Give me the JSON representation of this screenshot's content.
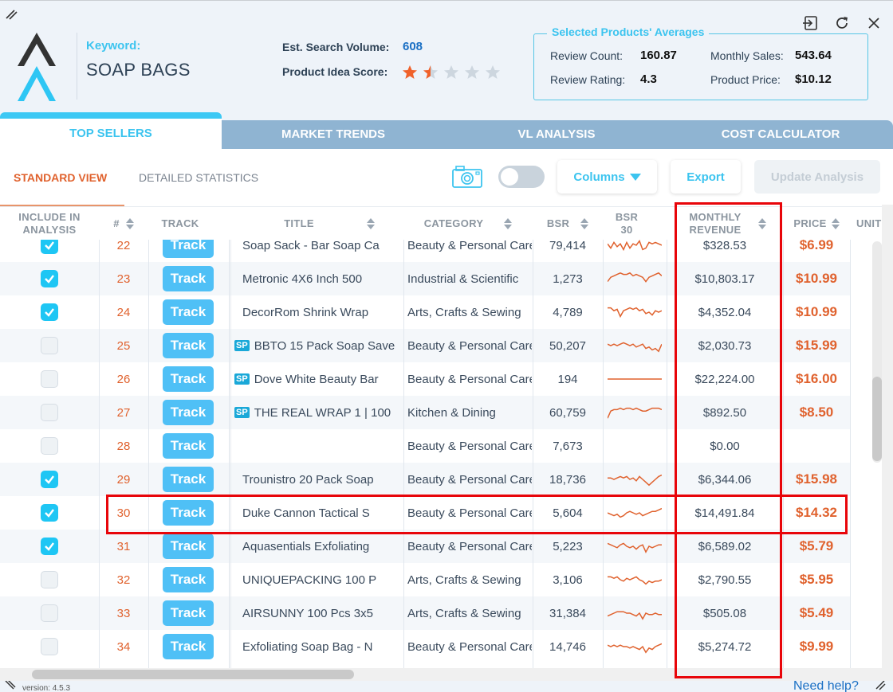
{
  "header": {
    "keyword_label": "Keyword:",
    "keyword_value": "SOAP BAGS",
    "search_volume_label": "Est. Search Volume:",
    "search_volume_value": "608",
    "idea_score_label": "Product Idea Score:",
    "idea_score_rating": 1.5,
    "idea_score_max": 5
  },
  "averages": {
    "title": "Selected Products' Averages",
    "review_count_label": "Review Count:",
    "review_count_value": "160.87",
    "monthly_sales_label": "Monthly Sales:",
    "monthly_sales_value": "543.64",
    "review_rating_label": "Review Rating:",
    "review_rating_value": "4.3",
    "product_price_label": "Product Price:",
    "product_price_value": "$10.12"
  },
  "window_icons": [
    "export-icon",
    "refresh-icon",
    "close-icon"
  ],
  "tabs": [
    {
      "label": "TOP SELLERS",
      "active": true
    },
    {
      "label": "MARKET TRENDS",
      "active": false
    },
    {
      "label": "VL ANALYSIS",
      "active": false
    },
    {
      "label": "COST CALCULATOR",
      "active": false
    }
  ],
  "subtabs": [
    {
      "label": "STANDARD VIEW",
      "active": true
    },
    {
      "label": "DETAILED STATISTICS",
      "active": false
    }
  ],
  "toolbar": {
    "columns_label": "Columns",
    "export_label": "Export",
    "update_label": "Update Analysis",
    "toggle_on": false
  },
  "table": {
    "headers": {
      "include": "INCLUDE IN ANALYSIS",
      "rank": "#",
      "track": "TRACK",
      "title": "TITLE",
      "category": "CATEGORY",
      "bsr": "BSR",
      "bsr30": "BSR 30",
      "revenue": "MONTHLY REVENUE",
      "price": "PRICE",
      "units": "UNIT"
    },
    "track_label": "Track",
    "sp_label": "SP",
    "rows": [
      {
        "checked": true,
        "rank": "22",
        "sp": false,
        "title": "Soap Sack - Bar Soap Ca",
        "category": "Beauty & Personal Care",
        "bsr": "79,414",
        "spark": [
          6,
          3,
          7,
          4,
          6,
          2,
          7,
          3,
          6,
          5,
          8,
          2,
          3,
          7,
          6,
          7,
          6,
          5
        ],
        "revenue": "$328.53",
        "price": "$6.99"
      },
      {
        "checked": true,
        "rank": "23",
        "sp": false,
        "title": "Metronic 4X6 Inch 500",
        "category": "Industrial & Scientific",
        "bsr": "1,273",
        "spark": [
          3,
          6,
          7,
          8,
          9,
          8,
          8,
          9,
          7,
          8,
          7,
          6,
          3,
          6,
          7,
          8,
          9,
          7
        ],
        "revenue": "$10,803.17",
        "price": "$10.99"
      },
      {
        "checked": true,
        "rank": "24",
        "sp": false,
        "title": "DecorRom Shrink Wrap",
        "category": "Arts, Crafts & Sewing",
        "bsr": "4,789",
        "spark": [
          8,
          8,
          6,
          7,
          2,
          6,
          7,
          8,
          7,
          8,
          6,
          7,
          4,
          5,
          3,
          6,
          5,
          6
        ],
        "revenue": "$4,352.04",
        "price": "$10.99"
      },
      {
        "checked": false,
        "rank": "25",
        "sp": true,
        "title": "BBTO 15 Pack Soap Save",
        "category": "Beauty & Personal Care",
        "bsr": "50,207",
        "spark": [
          6,
          5,
          6,
          5,
          6,
          7,
          6,
          5,
          6,
          4,
          5,
          6,
          3,
          4,
          2,
          3,
          1,
          6
        ],
        "revenue": "$2,030.73",
        "price": "$15.99"
      },
      {
        "checked": false,
        "rank": "26",
        "sp": true,
        "title": "Dove White Beauty Bar",
        "category": "Beauty & Personal Care",
        "bsr": "194",
        "spark": [
          5,
          5,
          5,
          5,
          5,
          5,
          5,
          5,
          5,
          5,
          5,
          5,
          5,
          5,
          5,
          5,
          5,
          5
        ],
        "revenue": "$22,224.00",
        "price": "$16.00"
      },
      {
        "checked": false,
        "rank": "27",
        "sp": true,
        "title": "THE REAL WRAP 1 | 100",
        "category": "Kitchen & Dining",
        "bsr": "60,759",
        "spark": [
          1,
          6,
          7,
          7,
          8,
          7,
          8,
          8,
          7,
          8,
          7,
          6,
          6,
          7,
          8,
          8,
          8,
          7
        ],
        "revenue": "$892.50",
        "price": "$8.50"
      },
      {
        "checked": false,
        "rank": "28",
        "sp": false,
        "title": "",
        "category": "Beauty & Personal Care",
        "bsr": "7,673",
        "spark": [],
        "revenue": "$0.00",
        "price": ""
      },
      {
        "checked": true,
        "rank": "29",
        "sp": false,
        "title": "Trounistro 20 Pack Soap",
        "category": "Beauty & Personal Care",
        "bsr": "18,736",
        "spark": [
          6,
          6,
          5,
          6,
          7,
          6,
          7,
          5,
          6,
          4,
          7,
          5,
          3,
          1,
          3,
          5,
          7,
          8
        ],
        "revenue": "$6,344.06",
        "price": "$15.98"
      },
      {
        "checked": true,
        "rank": "30",
        "sp": false,
        "title": "Duke Cannon Tactical S",
        "category": "Beauty & Personal Care",
        "bsr": "5,604",
        "spark": [
          5,
          4,
          3,
          4,
          2,
          3,
          5,
          6,
          5,
          4,
          5,
          3,
          4,
          5,
          6,
          6,
          7,
          8
        ],
        "revenue": "$14,491.84",
        "price": "$14.32"
      },
      {
        "checked": true,
        "rank": "31",
        "sp": false,
        "title": "Aquasentials Exfoliating",
        "category": "Beauty & Personal Care",
        "bsr": "5,223",
        "spark": [
          7,
          6,
          5,
          4,
          6,
          7,
          5,
          4,
          5,
          3,
          5,
          6,
          1,
          5,
          4,
          5,
          6,
          6
        ],
        "revenue": "$6,589.02",
        "price": "$5.79"
      },
      {
        "checked": false,
        "rank": "32",
        "sp": false,
        "title": "UNIQUEPACKING 100 P",
        "category": "Arts, Crafts & Sewing",
        "bsr": "3,106",
        "spark": [
          7,
          7,
          6,
          7,
          5,
          4,
          6,
          5,
          6,
          7,
          5,
          4,
          2,
          4,
          3,
          4,
          4,
          5
        ],
        "revenue": "$2,790.55",
        "price": "$5.95"
      },
      {
        "checked": false,
        "rank": "33",
        "sp": false,
        "title": "AIRSUNNY 100 Pcs 3x5",
        "category": "Arts, Crafts & Sewing",
        "bsr": "31,384",
        "spark": [
          3,
          4,
          5,
          6,
          6,
          6,
          5,
          5,
          4,
          3,
          5,
          1,
          5,
          4,
          4,
          5,
          4,
          4
        ],
        "revenue": "$505.08",
        "price": "$5.49"
      },
      {
        "checked": false,
        "rank": "34",
        "sp": false,
        "title": "Exfoliating Soap Bag - N",
        "category": "Beauty & Personal Care",
        "bsr": "14,746",
        "spark": [
          6,
          5,
          6,
          5,
          6,
          5,
          5,
          4,
          5,
          4,
          3,
          5,
          1,
          4,
          3,
          5,
          6,
          7
        ],
        "revenue": "$5,274.72",
        "price": "$9.99"
      }
    ]
  },
  "footer": {
    "version": "version: 4.5.3",
    "help_label": "Need help?"
  }
}
